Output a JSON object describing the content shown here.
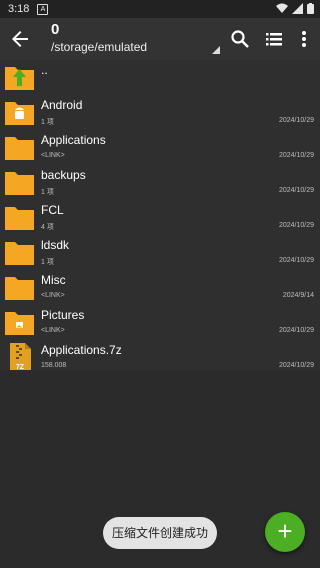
{
  "status": {
    "time": "3:18",
    "notif_glyph": "A"
  },
  "toolbar": {
    "count": "0",
    "path": "/storage/emulated",
    "icons": [
      "back-arrow-icon",
      "search-icon",
      "list-view-icon",
      "more-vert-icon"
    ]
  },
  "items": [
    {
      "name": "..",
      "meta": "",
      "date": "",
      "kind": "parent"
    },
    {
      "name": "Android",
      "meta": "1 项",
      "date": "2024/10/29",
      "kind": "folder-android"
    },
    {
      "name": "Applications",
      "meta": "<LINK>",
      "date": "2024/10/29",
      "kind": "folder"
    },
    {
      "name": "backups",
      "meta": "1 项",
      "date": "2024/10/29",
      "kind": "folder"
    },
    {
      "name": "FCL",
      "meta": "4 项",
      "date": "2024/10/29",
      "kind": "folder"
    },
    {
      "name": "ldsdk",
      "meta": "1 项",
      "date": "2024/10/29",
      "kind": "folder"
    },
    {
      "name": "Misc",
      "meta": "<LINK>",
      "date": "2024/9/14",
      "kind": "folder"
    },
    {
      "name": "Pictures",
      "meta": "<LINK>",
      "date": "2024/10/29",
      "kind": "folder-pictures"
    },
    {
      "name": "Applications.7z",
      "meta": "158.008",
      "date": "2024/10/29",
      "kind": "archive"
    }
  ],
  "archive_badge": "7Z",
  "toast": "压缩文件创建成功",
  "fab_symbol": "+",
  "colors": {
    "folder": "#f5a623",
    "fab": "#4caf23",
    "toolbar": "#333333"
  }
}
